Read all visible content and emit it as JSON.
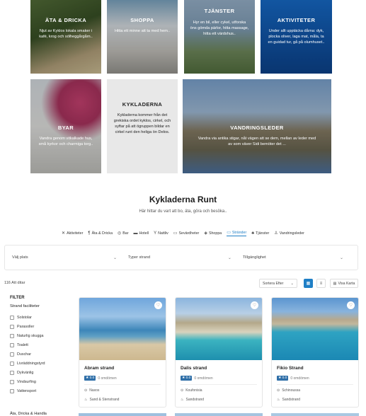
{
  "tiles": [
    {
      "title": "ÄTA & DRICKA",
      "desc": "Njut av Kyklos lokala smaker i kafé, krog och sólheggårgårn.."
    },
    {
      "title": "SHOPPA",
      "desc": "Hitta ett minne att ta med hem.."
    },
    {
      "title": "TJÄNSTER",
      "desc": "Hyr en bil, eller cykel, utforska öns gömda pärlor, hitta massage, hitta ett värdshus.."
    },
    {
      "title": "AKTIVITETER",
      "desc": "Under allt upptäcka dårna: dyk, plocka oliver, laga mat, måla, ta en guidad tur, gå på olumhuset.."
    },
    {
      "title": "BYAR",
      "desc": "Vandra genom vitkalkade hus, små kyrkor och charmiga torg.."
    },
    {
      "title": "KYKLADERNA",
      "desc": "Kykladerna kommer från det grekiska ordet kyklos, cirkel, och syftar på att ögruppen bildar en cirkel runt den heliga ön Delos."
    },
    {
      "title": "VANDRINGSLEDER",
      "desc": "Vandra via antika stigar, nåt vägen att se dem, mellan av leder med av som väver Sidi bemöter det ..."
    }
  ],
  "section": {
    "title": "Kykladerna Runt",
    "subtitle": "Här hittar du vart att bo, äta, göra och besöka.."
  },
  "categories": [
    {
      "icon": "✕",
      "label": "Aktiviteter",
      "active": false
    },
    {
      "icon": "¶",
      "label": "Äta & Dricka",
      "active": false
    },
    {
      "icon": "◎",
      "label": "Bar",
      "active": false
    },
    {
      "icon": "▬",
      "label": "Hotell",
      "active": false
    },
    {
      "icon": "Y",
      "label": "Nattliv",
      "active": false
    },
    {
      "icon": "▭",
      "label": "Sevärdheter",
      "active": false
    },
    {
      "icon": "◈",
      "label": "Shoppa",
      "active": false
    },
    {
      "icon": "▭",
      "label": "Stränder",
      "active": true
    },
    {
      "icon": "♣",
      "label": "Tjänster",
      "active": false
    },
    {
      "icon": "♙",
      "label": "Vandringsleder",
      "active": false
    }
  ],
  "filters": {
    "place": "Välj plats",
    "type": "Typer strand",
    "facility": "Tillgänglighet"
  },
  "results": {
    "count": "116 Att ditar",
    "sort": "Sortera Efter",
    "sort_icon": "chevron-down",
    "map_label": "Visa Karta"
  },
  "sidebar": {
    "heading": "FILTER",
    "group1": "Strand faciliteter",
    "options": [
      "Solstolar",
      "Parasoller",
      "Naturlig skugga",
      "Toalett",
      "Duschar",
      "Livräddningstyrd",
      "Dykvänlig",
      "Vindsurfing",
      "Vattensport"
    ],
    "group2": "Äta, Dricka & Handla"
  },
  "cards": [
    {
      "name": "Abram strand",
      "rating": "★ 0.0",
      "reviews": "0 omdömen",
      "place": "Naxos",
      "type": "Sand & Stenstrand"
    },
    {
      "name": "Dalis strand",
      "rating": "★ 0.0",
      "reviews": "0 omdömen",
      "place": "Koufonisia",
      "type": "Sandstrand"
    },
    {
      "name": "Fikio Strand",
      "rating": "★ 0.0",
      "reviews": "0 omdömen",
      "place": "Schinoussa",
      "type": "Sandstrand"
    }
  ],
  "colors": {
    "accent": "#1f7fc6",
    "badge": "#2f6fa8",
    "view_active": "#1f7fc6"
  }
}
